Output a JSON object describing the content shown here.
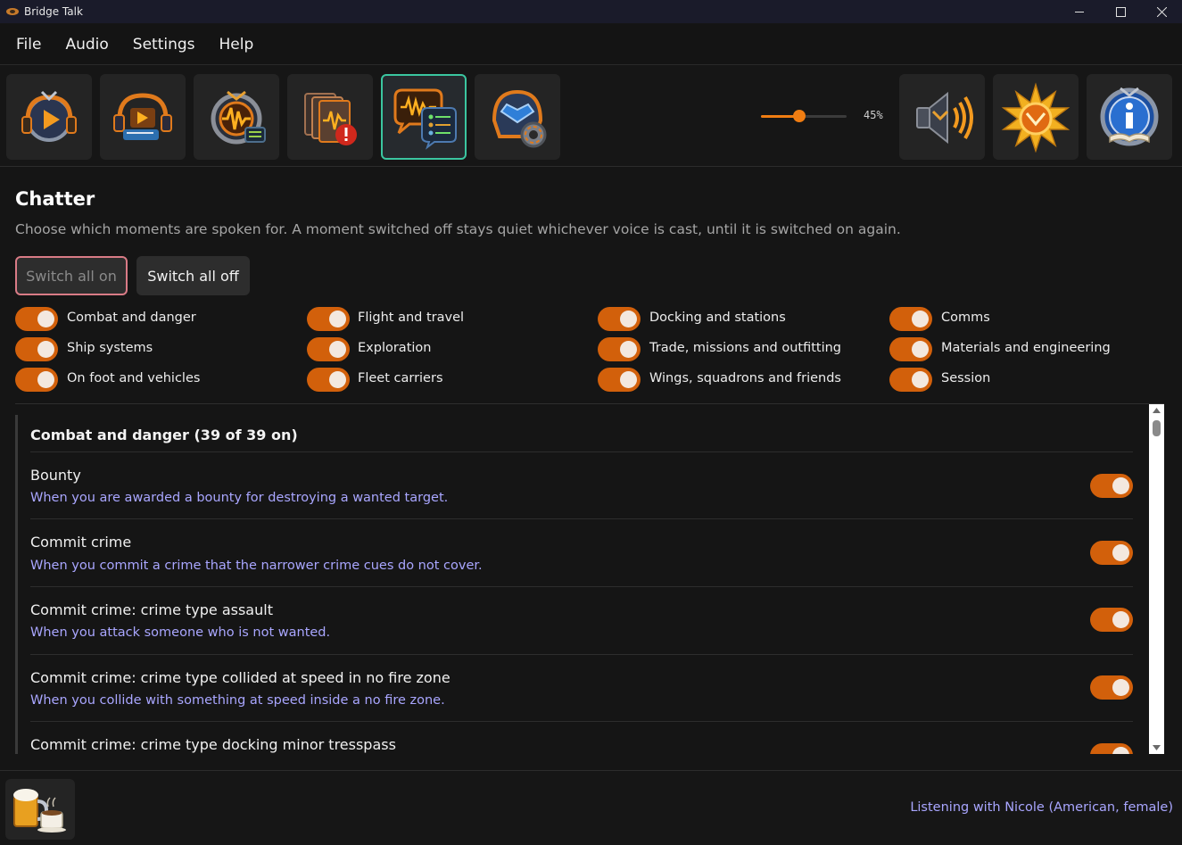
{
  "window": {
    "title": "Bridge Talk"
  },
  "menu": [
    "File",
    "Audio",
    "Settings",
    "Help"
  ],
  "toolbar": {
    "buttons": [
      {
        "icon": "voice-play-icon",
        "active": false
      },
      {
        "icon": "sound-library-icon",
        "active": false
      },
      {
        "icon": "waveform-settings-icon",
        "active": false
      },
      {
        "icon": "alert-cards-icon",
        "active": false
      },
      {
        "icon": "chatter-icon",
        "active": true
      },
      {
        "icon": "helmet-settings-icon",
        "active": false
      }
    ],
    "volume_value": 45,
    "volume_label": "45%",
    "right_buttons": [
      {
        "icon": "speaker-icon"
      },
      {
        "icon": "sun-emblem-icon"
      },
      {
        "icon": "info-book-icon"
      }
    ]
  },
  "chatter": {
    "heading": "Chatter",
    "description": "Choose which moments are spoken for. A moment switched off stays quiet whichever voice is cast, until it is switched on again.",
    "switch_all_on": "Switch all on",
    "switch_all_off": "Switch all off",
    "categories": [
      {
        "label": "Combat and danger",
        "on": true
      },
      {
        "label": "Flight and travel",
        "on": true
      },
      {
        "label": "Docking and stations",
        "on": true
      },
      {
        "label": "Comms",
        "on": true
      },
      {
        "label": "Ship systems",
        "on": true
      },
      {
        "label": "Exploration",
        "on": true
      },
      {
        "label": "Trade, missions and outfitting",
        "on": true
      },
      {
        "label": "Materials and engineering",
        "on": true
      },
      {
        "label": "On foot and vehicles",
        "on": true
      },
      {
        "label": "Fleet carriers",
        "on": true
      },
      {
        "label": "Wings, squadrons and friends",
        "on": true
      },
      {
        "label": "Session",
        "on": true
      }
    ]
  },
  "list": {
    "group_title": "Combat and danger (39 of 39 on)",
    "rows": [
      {
        "title": "Bounty",
        "desc": "When you are awarded a bounty for destroying a wanted target.",
        "on": true
      },
      {
        "title": "Commit crime",
        "desc": "When you commit a crime that the narrower crime cues do not cover.",
        "on": true
      },
      {
        "title": "Commit crime: crime type assault",
        "desc": "When you attack someone who is not wanted.",
        "on": true
      },
      {
        "title": "Commit crime: crime type collided at speed in no fire zone",
        "desc": "When you collide with something at speed inside a no fire zone.",
        "on": true
      },
      {
        "title": "Commit crime: crime type docking minor tresspass",
        "desc": "",
        "on": true
      }
    ]
  },
  "footer": {
    "icon": "beer-coffee-icon",
    "status": "Listening with Nicole (American, female)"
  },
  "colors": {
    "accent": "#f07d12",
    "toggle_on": "#d2600b",
    "active_border": "#3bc6a0",
    "link": "#a9a6ff"
  }
}
